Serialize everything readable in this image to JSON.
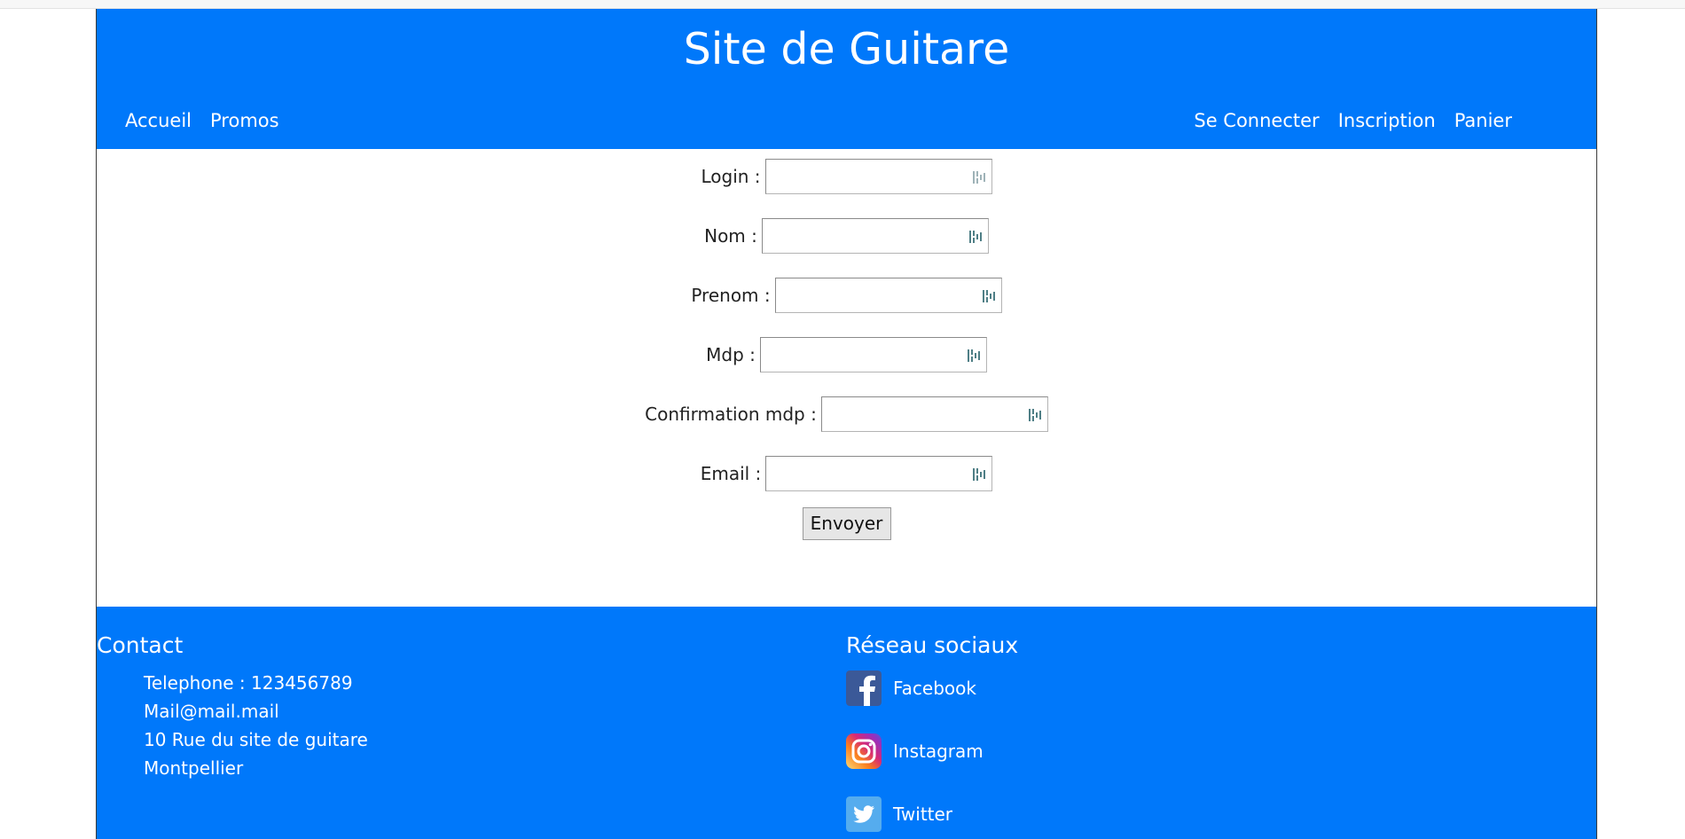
{
  "header": {
    "title": "Site de Guitare",
    "nav_left": [
      "Accueil",
      "Promos"
    ],
    "nav_right": [
      "Se Connecter",
      "Inscription",
      "Panier"
    ]
  },
  "form": {
    "fields": [
      {
        "label": "Login :",
        "value": ""
      },
      {
        "label": "Nom :",
        "value": ""
      },
      {
        "label": "Prenom :",
        "value": ""
      },
      {
        "label": "Mdp :",
        "value": ""
      },
      {
        "label": "Confirmation mdp :",
        "value": ""
      },
      {
        "label": "Email :",
        "value": ""
      }
    ],
    "submit_label": "Envoyer",
    "field_icon": "password-manager-icon"
  },
  "footer": {
    "contact_title": "Contact",
    "contact_lines": [
      "Telephone : 123456789",
      "Mail@mail.mail",
      "10 Rue du site de guitare",
      "Montpellier"
    ],
    "social_title": "Réseau sociaux",
    "social": [
      {
        "label": "Facebook",
        "icon": "facebook-icon"
      },
      {
        "label": "Instagram",
        "icon": "instagram-icon"
      },
      {
        "label": "Twitter",
        "icon": "twitter-icon"
      }
    ]
  },
  "colors": {
    "brand_blue": "#0078fa",
    "facebook": "#3b5998",
    "twitter": "#55acee"
  }
}
